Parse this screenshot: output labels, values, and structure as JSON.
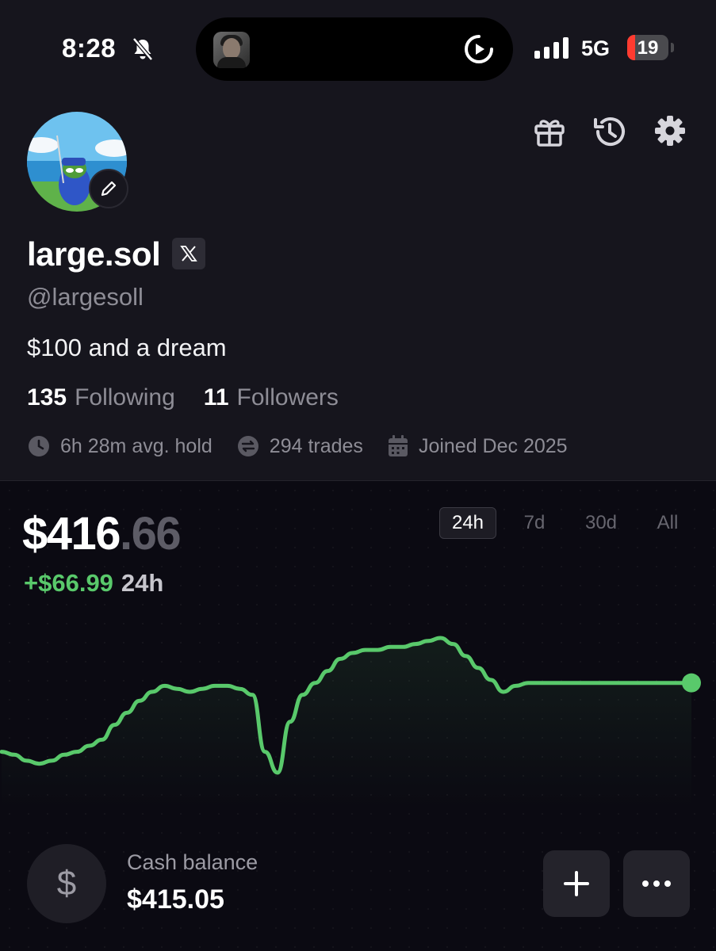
{
  "status_bar": {
    "time": "8:28",
    "network": "5G",
    "battery": "19",
    "icons": [
      "bell-slash-icon",
      "play-icon",
      "signal-icon"
    ]
  },
  "header_icons": [
    "gift-icon",
    "history-icon",
    "gear-icon"
  ],
  "profile": {
    "name": "large.sol",
    "handle": "@largesoll",
    "bio": "$100 and a dream",
    "following_count": "135",
    "following_label": "Following",
    "followers_count": "11",
    "followers_label": "Followers",
    "avg_hold": "6h 28m avg. hold",
    "trades": "294 trades",
    "joined": "Joined Dec 2025"
  },
  "portfolio": {
    "value_main": "$416",
    "value_cents": ".66",
    "change": "+$66.99",
    "change_period": "24h",
    "ranges": [
      "24h",
      "7d",
      "30d",
      "All"
    ],
    "active_range": "24h",
    "line_color": "#59c96b"
  },
  "chart_data": {
    "type": "line",
    "series": [
      {
        "values": [
          352,
          351,
          349,
          348,
          349,
          351,
          352,
          354,
          356,
          361,
          365,
          369,
          372,
          374,
          373,
          372,
          373,
          374,
          374,
          373,
          371,
          352,
          345,
          362,
          371,
          375,
          379,
          383,
          385,
          386,
          386,
          387,
          387,
          388,
          389,
          390,
          388,
          384,
          380,
          376,
          372,
          374,
          375,
          375,
          375,
          375,
          375,
          375,
          375,
          375,
          375,
          375,
          375,
          375,
          375,
          375
        ]
      }
    ],
    "grid": false,
    "axes": false
  },
  "cash": {
    "label": "Cash balance",
    "value": "$415.05",
    "icon": "$"
  }
}
